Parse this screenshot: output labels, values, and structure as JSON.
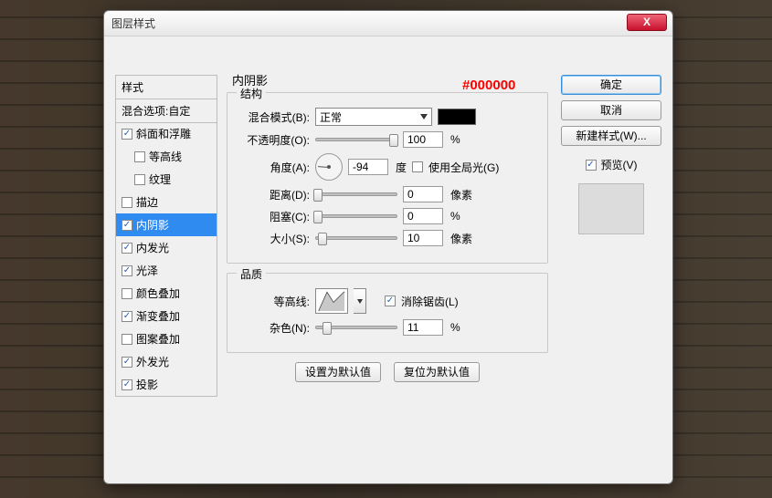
{
  "window": {
    "title": "图层样式",
    "close": "X"
  },
  "sidebar": {
    "header1": "样式",
    "header2": "混合选项:自定",
    "items": [
      {
        "label": "斜面和浮雕",
        "checked": true,
        "indent": false
      },
      {
        "label": "等高线",
        "checked": false,
        "indent": true
      },
      {
        "label": "纹理",
        "checked": false,
        "indent": true
      },
      {
        "label": "描边",
        "checked": false,
        "indent": false
      },
      {
        "label": "内阴影",
        "checked": true,
        "indent": false,
        "selected": true
      },
      {
        "label": "内发光",
        "checked": true,
        "indent": false
      },
      {
        "label": "光泽",
        "checked": true,
        "indent": false
      },
      {
        "label": "颜色叠加",
        "checked": false,
        "indent": false
      },
      {
        "label": "渐变叠加",
        "checked": true,
        "indent": false
      },
      {
        "label": "图案叠加",
        "checked": false,
        "indent": false
      },
      {
        "label": "外发光",
        "checked": true,
        "indent": false
      },
      {
        "label": "投影",
        "checked": true,
        "indent": false
      }
    ]
  },
  "main": {
    "title": "内阴影",
    "structure": {
      "legend": "结构",
      "blend_label": "混合模式(B):",
      "blend_value": "正常",
      "color": "#000000",
      "opacity_label": "不透明度(O):",
      "opacity_value": "100",
      "opacity_unit": "%",
      "angle_label": "角度(A):",
      "angle_value": "-94",
      "angle_unit": "度",
      "global_label": "使用全局光(G)",
      "distance_label": "距离(D):",
      "distance_value": "0",
      "distance_unit": "像素",
      "choke_label": "阻塞(C):",
      "choke_value": "0",
      "choke_unit": "%",
      "size_label": "大小(S):",
      "size_value": "10",
      "size_unit": "像素"
    },
    "quality": {
      "legend": "品质",
      "contour_label": "等高线:",
      "aa_label": "消除锯齿(L)",
      "noise_label": "杂色(N):",
      "noise_value": "11",
      "noise_unit": "%"
    },
    "reset_btn": "设置为默认值",
    "restore_btn": "复位为默认值"
  },
  "right": {
    "ok": "确定",
    "cancel": "取消",
    "newstyle": "新建样式(W)...",
    "preview": "预览(V)"
  },
  "annotation": "#000000"
}
